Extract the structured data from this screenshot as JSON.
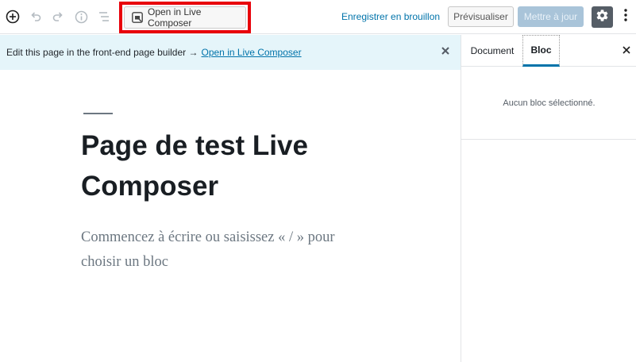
{
  "toolbar": {
    "icons": [
      "add-block-icon",
      "undo-icon",
      "redo-icon",
      "info-icon",
      "block-navigation-icon"
    ],
    "live_composer_label": "Open in Live Composer",
    "save_draft_label": "Enregistrer en brouillon",
    "preview_label": "Prévisualiser",
    "update_label": "Mettre à jour",
    "colors": {
      "highlight": "#e8000a",
      "link": "#0073aa",
      "settings_bg": "#555d66",
      "update_disabled_bg": "#a9c4d9"
    }
  },
  "notice": {
    "text": "Edit this page in the front-end page builder →",
    "link_label": "Open in Live Composer",
    "background": "#e5f5fa"
  },
  "editor": {
    "title": "Page de test Live Composer",
    "placeholder": "Commencez à écrire ou saisissez « / » pour choisir un bloc"
  },
  "sidebar": {
    "tabs": [
      {
        "label": "Document",
        "active": false
      },
      {
        "label": "Bloc",
        "active": true
      }
    ],
    "empty_message": "Aucun bloc sélectionné."
  }
}
